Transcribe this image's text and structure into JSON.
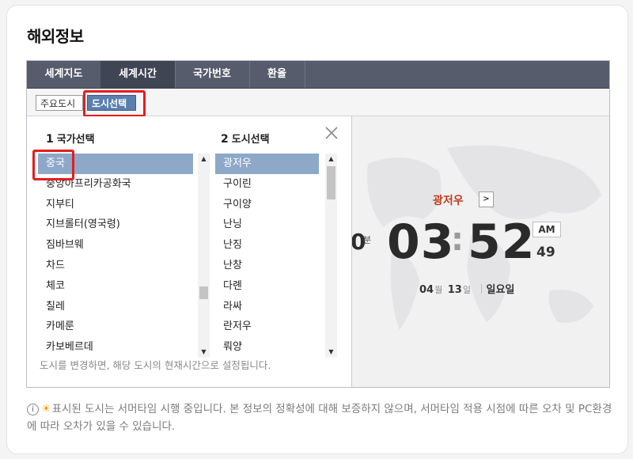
{
  "page": {
    "title": "해외정보"
  },
  "tabs": [
    {
      "label": "세계지도"
    },
    {
      "label": "세계시간",
      "active": true
    },
    {
      "label": "국가번호"
    },
    {
      "label": "환율"
    }
  ],
  "subnav": {
    "major_cities": "주요도시",
    "select_city": "도시선택"
  },
  "country_panel": {
    "step": "1",
    "label": "국가선택",
    "items": [
      "중국",
      "중앙아프리카공화국",
      "지부티",
      "지브롤터(영국령)",
      "짐바브웨",
      "차드",
      "체코",
      "칠레",
      "카메룬",
      "카보베르데"
    ],
    "selected": "중국"
  },
  "city_panel": {
    "step": "2",
    "label": "도시선택",
    "items": [
      "광저우",
      "구이린",
      "구이양",
      "난닝",
      "난징",
      "난창",
      "다롄",
      "라싸",
      "란저우",
      "뤄양"
    ],
    "selected": "광저우"
  },
  "hint": "도시를 변경하면, 해당 도시의 현재시간으로 설정됩니다.",
  "clock": {
    "city": "광저우",
    "next_glyph": ">",
    "left_digit": "0",
    "left_unit": "분",
    "hours": "03",
    "colon": ":",
    "minutes": "52",
    "ampm": "AM",
    "seconds": "49",
    "month": "04",
    "month_unit": "월",
    "day": "13",
    "day_unit": "일",
    "weekday": "일요일"
  },
  "notice": {
    "text": "표시된 도시는 서머타임 시행 중입니다. 본 정보의 정확성에 대해 보증하지 않으며, 서머타임 적용 시점에 따른 오차 및 PC환경에 따라 오차가 있을 수 있습니다."
  },
  "colors": {
    "tab_bg": "#565c6c",
    "selected_item": "#8ea8c8",
    "city_red": "#c43a1d",
    "highlight_red": "#e51d1d"
  }
}
